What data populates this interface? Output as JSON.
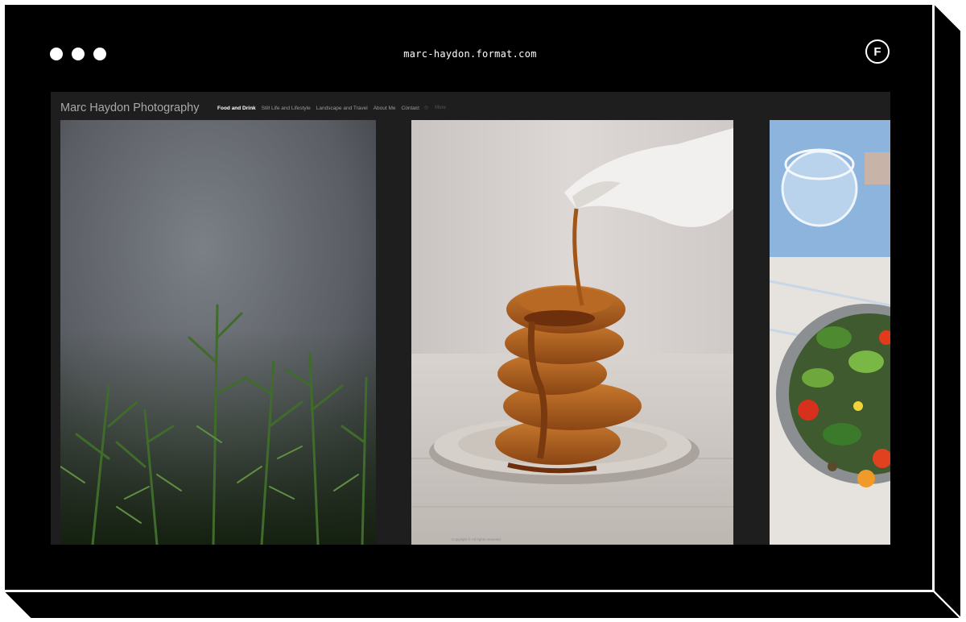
{
  "browser": {
    "url": "marc-haydon.format.com",
    "logo_letter": "F"
  },
  "site": {
    "title": "Marc Haydon Photography",
    "nav": [
      {
        "label": "Food and Drink",
        "active": true
      },
      {
        "label": "Still Life and Lifestyle",
        "active": false
      },
      {
        "label": "Landscape and Travel",
        "active": false
      },
      {
        "label": "About Me",
        "active": false
      },
      {
        "label": "Contact",
        "active": false
      }
    ],
    "social_icons": [
      "instagram-icon",
      "twitter-icon",
      "facebook-icon"
    ],
    "more_label": "More"
  },
  "gallery": {
    "photos": [
      {
        "subject": "rosemary-plant"
      },
      {
        "subject": "yorkshire-puddings-gravy"
      },
      {
        "subject": "salad-bowl"
      }
    ],
    "copyright": "Copyright © All rights reserved"
  },
  "colors": {
    "frame": "#000000",
    "site_bg": "#1e1e1e",
    "nav_active": "#ffffff",
    "nav_inactive": "#9a9a9a"
  }
}
